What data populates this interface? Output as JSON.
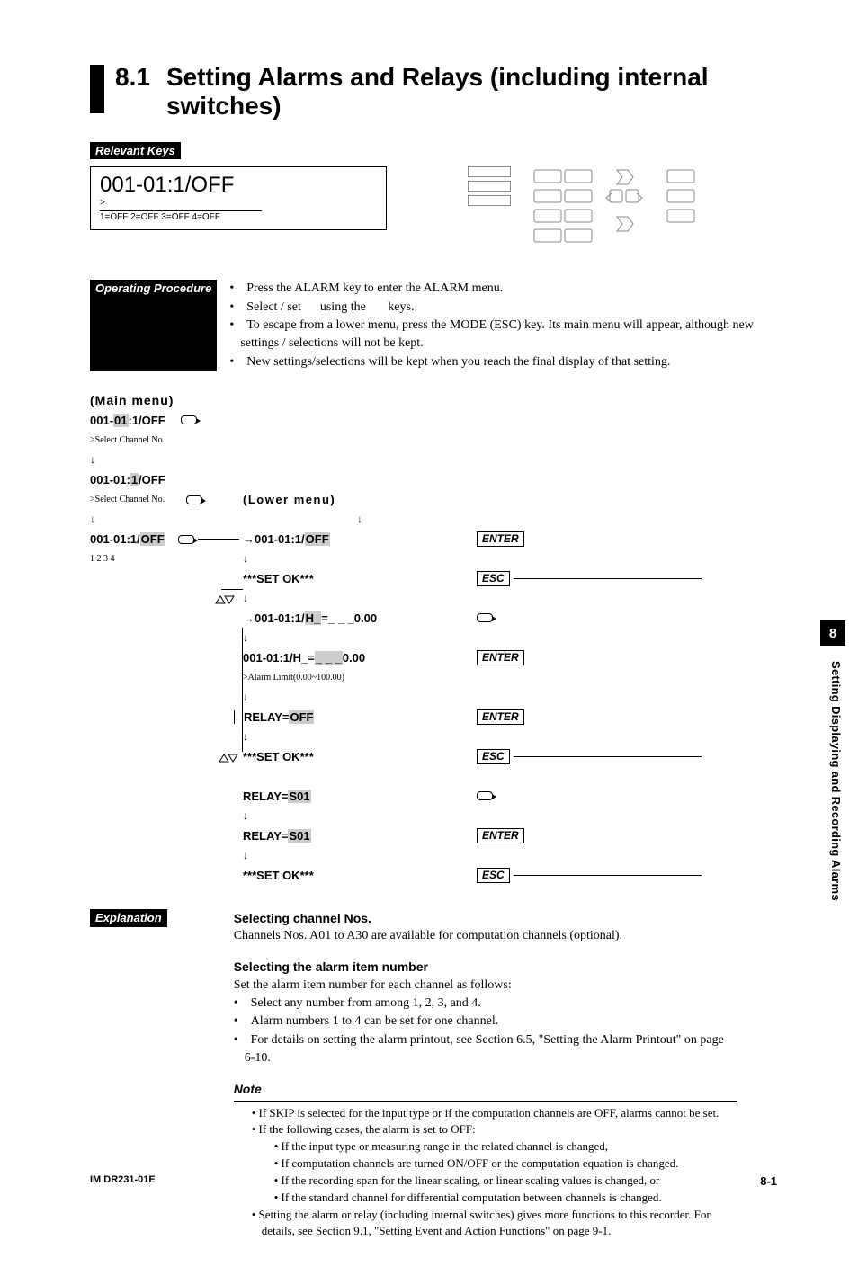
{
  "side": {
    "tab": "8",
    "caption": "Setting Displaying and Recording Alarms"
  },
  "title": {
    "num": "8.1",
    "text1": "Setting Alarms and Relays (including internal",
    "text2": "switches)"
  },
  "labels": {
    "relevant": "Relevant Keys",
    "procedure": "Operating Procedure",
    "explanation": "Explanation",
    "main_menu": "(Main menu)",
    "lower_menu": "(Lower menu)",
    "note": "Note"
  },
  "lcd": {
    "main": "001-01:1/OFF",
    "prompt": ">",
    "sub": "1=OFF 2=OFF 3=OFF 4=OFF"
  },
  "procedure": {
    "items": [
      "• Press the ALARM key to enter the ALARM menu.",
      "• Select / set      using the       keys.",
      "• To escape from a lower menu, press the MODE (ESC) key.  Its main menu will appear, although new settings / selections will not be kept.",
      "• New settings/selections will be kept when you reach the final display of that setting."
    ]
  },
  "flow": {
    "left": [
      {
        "pre": "001-",
        "hl": "01",
        "post": ":1/OFF",
        "sub": ">Select Channel No."
      },
      {
        "pre": "001-01:",
        "hl": "1",
        "post": "/OFF",
        "sub": ">Select Channel No."
      },
      {
        "pre": "001-01:1/",
        "hl": "OFF",
        "post": "",
        "sub": "1 2 3 4"
      }
    ],
    "mid": [
      {
        "pre": "001-01:1/",
        "hl": "OFF",
        "post": "",
        "key": "ENTER"
      },
      {
        "pre": "***SET OK***",
        "plain": true,
        "key": "ESC"
      },
      {
        "pre": "001-01:1/",
        "hl": "H_",
        "post": "=_ _ _0.00",
        "key": "ENTERICON"
      },
      {
        "pre": "001-01:1/H_=",
        "hl": "_ _ _",
        "post": "0.00",
        "sub": ">Alarm Limit(0.00~100.00)",
        "key": "ENTER"
      },
      {
        "pre": "RELAY=",
        "hl": "OFF",
        "post": "",
        "key": "ENTER"
      },
      {
        "pre": "***SET OK***",
        "plain": true,
        "key": "ESC",
        "updown": true
      },
      {
        "pre": "RELAY=",
        "hl": "S01",
        "post": "",
        "key": "ENTERICON"
      },
      {
        "pre": "RELAY=",
        "hl": "S01",
        "post": "",
        "key": "ENTER"
      },
      {
        "pre": "***SET OK***",
        "plain": true,
        "key": "ESC"
      }
    ]
  },
  "explanation": {
    "h1": "Selecting channel Nos.",
    "p1": "Channels Nos. A01 to A30 are available for computation channels (optional).",
    "h2": "Selecting the alarm item number",
    "p2": "Set the alarm item number for each channel as follows:",
    "bul": [
      "• Select any number from among 1, 2, 3, and 4.",
      "• Alarm numbers 1 to 4 can be set for one channel.",
      "• For details on setting the alarm printout, see Section 6.5, \"Setting the Alarm Printout\" on page 6-10."
    ],
    "note_items": [
      "• If SKIP is selected for the input type or if the computation channels are OFF, alarms cannot be set.",
      "• If the following cases, the alarm is set to OFF:",
      "• If the input type or measuring range in the related channel is changed,",
      "• If computation channels are turned ON/OFF or the computation equation is changed.",
      "• If the recording span for the linear scaling, or linear scaling values is changed, or",
      "• If the standard channel for differential computation between channels is changed.",
      "• Setting the alarm or relay (including internal switches) gives more functions to this recorder.  For details, see Section 9.1, \"Setting Event and Action Functions\" on page 9-1."
    ]
  },
  "footer": {
    "left": "IM DR231-01E",
    "right": "8-1"
  }
}
